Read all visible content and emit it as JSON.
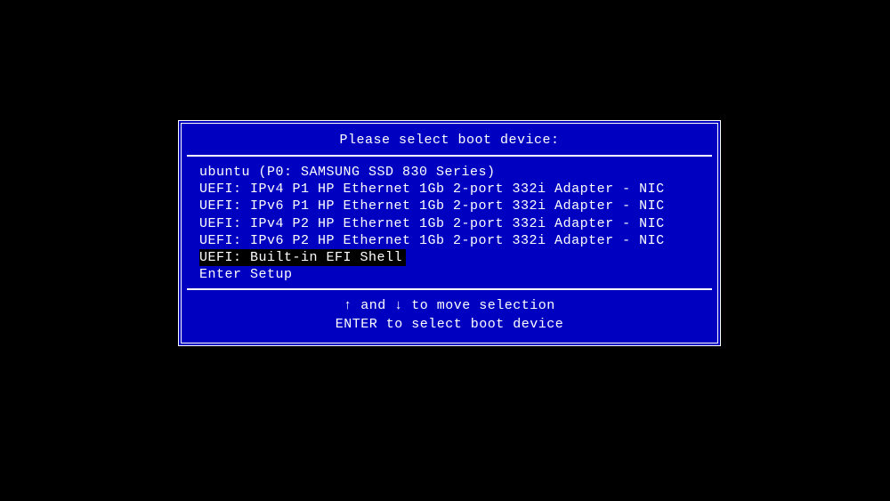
{
  "title": "Please select boot device:",
  "devices": [
    {
      "label": "ubuntu (P0: SAMSUNG SSD 830 Series)",
      "selected": false
    },
    {
      "label": "UEFI: IPv4 P1 HP Ethernet 1Gb 2-port 332i Adapter - NIC",
      "selected": false
    },
    {
      "label": "UEFI: IPv6 P1 HP Ethernet 1Gb 2-port 332i Adapter - NIC",
      "selected": false
    },
    {
      "label": "UEFI: IPv4 P2 HP Ethernet 1Gb 2-port 332i Adapter - NIC",
      "selected": false
    },
    {
      "label": "UEFI: IPv6 P2 HP Ethernet 1Gb 2-port 332i Adapter - NIC",
      "selected": false
    },
    {
      "label": "UEFI: Built-in EFI Shell",
      "selected": true
    },
    {
      "label": "Enter Setup",
      "selected": false
    }
  ],
  "hints": {
    "arrow_up": "↑",
    "arrow_down": "↓",
    "move_pre": " and ",
    "move_post": " to move selection",
    "enter": "ENTER to select boot device"
  }
}
